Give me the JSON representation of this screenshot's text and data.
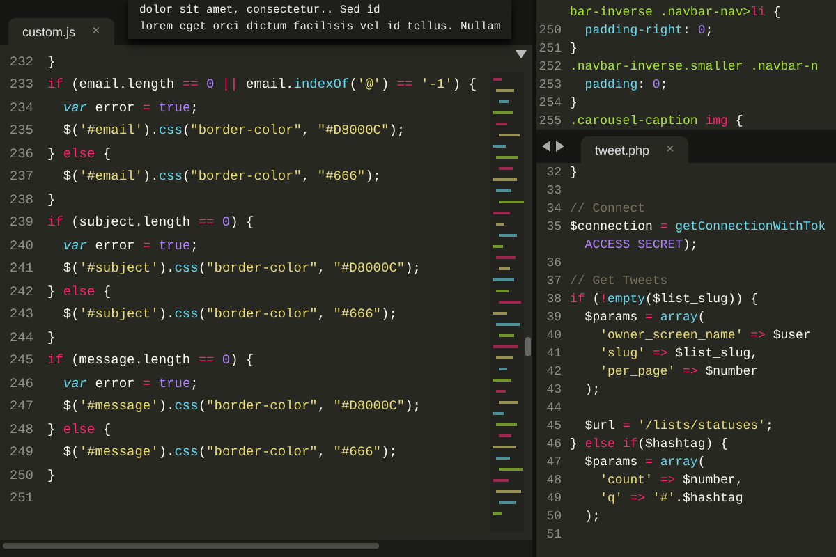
{
  "left_pane": {
    "tab": {
      "label": "custom.js",
      "close": "×"
    },
    "popup": {
      "lines": [
        "dolor sit amet, consectetur.. Sed id",
        "lorem eget orci dictum facilisis vel id tellus. Nullam"
      ]
    },
    "lines": [
      {
        "num": "232",
        "tokens": [
          {
            "kind": "txt",
            "text": "}"
          }
        ]
      },
      {
        "num": "233",
        "tokens": [
          {
            "kind": "kw",
            "text": "if"
          },
          {
            "kind": "txt",
            "text": " (email.length "
          },
          {
            "kind": "kw",
            "text": "=="
          },
          {
            "kind": "num",
            "text": " 0"
          },
          {
            "kind": "kw",
            "text": " ||"
          },
          {
            "kind": "txt",
            "text": " email."
          },
          {
            "kind": "fn",
            "text": "indexOf"
          },
          {
            "kind": "txt",
            "text": "("
          },
          {
            "kind": "str",
            "text": "'@'"
          },
          {
            "kind": "txt",
            "text": ") "
          },
          {
            "kind": "kw",
            "text": "=="
          },
          {
            "kind": "str",
            "text": " '-1'"
          },
          {
            "kind": "txt",
            "text": ") {"
          }
        ]
      },
      {
        "num": "234",
        "tokens": [
          {
            "kind": "var",
            "text": "  var"
          },
          {
            "kind": "txt",
            "text": " error "
          },
          {
            "kind": "kw",
            "text": "="
          },
          {
            "kind": "num",
            "text": " true"
          },
          {
            "kind": "txt",
            "text": ";"
          }
        ]
      },
      {
        "num": "235",
        "tokens": [
          {
            "kind": "txt",
            "text": "  $("
          },
          {
            "kind": "str",
            "text": "'#email'"
          },
          {
            "kind": "txt",
            "text": ")."
          },
          {
            "kind": "fn",
            "text": "css"
          },
          {
            "kind": "txt",
            "text": "("
          },
          {
            "kind": "str",
            "text": "\"border-color\""
          },
          {
            "kind": "txt",
            "text": ", "
          },
          {
            "kind": "str",
            "text": "\"#D8000C\""
          },
          {
            "kind": "txt",
            "text": ");"
          }
        ]
      },
      {
        "num": "236",
        "tokens": [
          {
            "kind": "txt",
            "text": "} "
          },
          {
            "kind": "kw",
            "text": "else"
          },
          {
            "kind": "txt",
            "text": " {"
          }
        ]
      },
      {
        "num": "237",
        "tokens": [
          {
            "kind": "txt",
            "text": "  $("
          },
          {
            "kind": "str",
            "text": "'#email'"
          },
          {
            "kind": "txt",
            "text": ")."
          },
          {
            "kind": "fn",
            "text": "css"
          },
          {
            "kind": "txt",
            "text": "("
          },
          {
            "kind": "str",
            "text": "\"border-color\""
          },
          {
            "kind": "txt",
            "text": ", "
          },
          {
            "kind": "str",
            "text": "\"#666\""
          },
          {
            "kind": "txt",
            "text": ");"
          }
        ]
      },
      {
        "num": "238",
        "tokens": [
          {
            "kind": "txt",
            "text": "}"
          }
        ]
      },
      {
        "num": "239",
        "tokens": [
          {
            "kind": "kw",
            "text": "if"
          },
          {
            "kind": "txt",
            "text": " (subject.length "
          },
          {
            "kind": "kw",
            "text": "=="
          },
          {
            "kind": "num",
            "text": " 0"
          },
          {
            "kind": "txt",
            "text": ") {"
          }
        ]
      },
      {
        "num": "240",
        "tokens": [
          {
            "kind": "var",
            "text": "  var"
          },
          {
            "kind": "txt",
            "text": " error "
          },
          {
            "kind": "kw",
            "text": "="
          },
          {
            "kind": "num",
            "text": " true"
          },
          {
            "kind": "txt",
            "text": ";"
          }
        ]
      },
      {
        "num": "241",
        "tokens": [
          {
            "kind": "txt",
            "text": "  $("
          },
          {
            "kind": "str",
            "text": "'#subject'"
          },
          {
            "kind": "txt",
            "text": ")."
          },
          {
            "kind": "fn",
            "text": "css"
          },
          {
            "kind": "txt",
            "text": "("
          },
          {
            "kind": "str",
            "text": "\"border-color\""
          },
          {
            "kind": "txt",
            "text": ", "
          },
          {
            "kind": "str",
            "text": "\"#D8000C\""
          },
          {
            "kind": "txt",
            "text": ");"
          }
        ]
      },
      {
        "num": "242",
        "tokens": [
          {
            "kind": "txt",
            "text": "} "
          },
          {
            "kind": "kw",
            "text": "else"
          },
          {
            "kind": "txt",
            "text": " {"
          }
        ]
      },
      {
        "num": "243",
        "tokens": [
          {
            "kind": "txt",
            "text": "  $("
          },
          {
            "kind": "str",
            "text": "'#subject'"
          },
          {
            "kind": "txt",
            "text": ")."
          },
          {
            "kind": "fn",
            "text": "css"
          },
          {
            "kind": "txt",
            "text": "("
          },
          {
            "kind": "str",
            "text": "\"border-color\""
          },
          {
            "kind": "txt",
            "text": ", "
          },
          {
            "kind": "str",
            "text": "\"#666\""
          },
          {
            "kind": "txt",
            "text": ");"
          }
        ]
      },
      {
        "num": "244",
        "tokens": [
          {
            "kind": "txt",
            "text": "}"
          }
        ]
      },
      {
        "num": "245",
        "tokens": [
          {
            "kind": "kw",
            "text": "if"
          },
          {
            "kind": "txt",
            "text": " (message.length "
          },
          {
            "kind": "kw",
            "text": "=="
          },
          {
            "kind": "num",
            "text": " 0"
          },
          {
            "kind": "txt",
            "text": ") {"
          }
        ]
      },
      {
        "num": "246",
        "tokens": [
          {
            "kind": "var",
            "text": "  var"
          },
          {
            "kind": "txt",
            "text": " error "
          },
          {
            "kind": "kw",
            "text": "="
          },
          {
            "kind": "num",
            "text": " true"
          },
          {
            "kind": "txt",
            "text": ";"
          }
        ]
      },
      {
        "num": "247",
        "tokens": [
          {
            "kind": "txt",
            "text": "  $("
          },
          {
            "kind": "str",
            "text": "'#message'"
          },
          {
            "kind": "txt",
            "text": ")."
          },
          {
            "kind": "fn",
            "text": "css"
          },
          {
            "kind": "txt",
            "text": "("
          },
          {
            "kind": "str",
            "text": "\"border-color\""
          },
          {
            "kind": "txt",
            "text": ", "
          },
          {
            "kind": "str",
            "text": "\"#D8000C\""
          },
          {
            "kind": "txt",
            "text": ");"
          }
        ]
      },
      {
        "num": "248",
        "tokens": [
          {
            "kind": "txt",
            "text": "} "
          },
          {
            "kind": "kw",
            "text": "else"
          },
          {
            "kind": "txt",
            "text": " {"
          }
        ]
      },
      {
        "num": "249",
        "tokens": [
          {
            "kind": "txt",
            "text": "  $("
          },
          {
            "kind": "str",
            "text": "'#message'"
          },
          {
            "kind": "txt",
            "text": ")."
          },
          {
            "kind": "fn",
            "text": "css"
          },
          {
            "kind": "txt",
            "text": "("
          },
          {
            "kind": "str",
            "text": "\"border-color\""
          },
          {
            "kind": "txt",
            "text": ", "
          },
          {
            "kind": "str",
            "text": "\"#666\""
          },
          {
            "kind": "txt",
            "text": ");"
          }
        ]
      },
      {
        "num": "250",
        "tokens": [
          {
            "kind": "txt",
            "text": "}"
          }
        ]
      },
      {
        "num": "251"
      }
    ]
  },
  "right_top_pane": {
    "lines": [
      {
        "tokens": [
          {
            "kind": "sel",
            "text": "bar-inverse .navbar-nav>"
          },
          {
            "kind": "kw",
            "text": "li"
          },
          {
            "kind": "txt",
            "text": " {"
          }
        ]
      },
      {
        "num": "250",
        "tokens": [
          {
            "kind": "prop",
            "text": "  padding-right"
          },
          {
            "kind": "txt",
            "text": ": "
          },
          {
            "kind": "num",
            "text": "0"
          },
          {
            "kind": "txt",
            "text": ";"
          }
        ]
      },
      {
        "num": "251",
        "tokens": [
          {
            "kind": "txt",
            "text": "}"
          }
        ]
      },
      {
        "num": "252",
        "tokens": [
          {
            "kind": "sel",
            "text": ".navbar-inverse.smaller .navbar-n"
          }
        ]
      },
      {
        "num": "253",
        "tokens": [
          {
            "kind": "prop",
            "text": "  padding"
          },
          {
            "kind": "txt",
            "text": ": "
          },
          {
            "kind": "num",
            "text": "0"
          },
          {
            "kind": "txt",
            "text": ";"
          }
        ]
      },
      {
        "num": "254",
        "tokens": [
          {
            "kind": "txt",
            "text": "}"
          }
        ]
      },
      {
        "num": "255",
        "tokens": [
          {
            "kind": "sel",
            "text": ".carousel-caption "
          },
          {
            "kind": "kw",
            "text": "img"
          },
          {
            "kind": "txt",
            "text": " {"
          }
        ]
      }
    ]
  },
  "right_bottom_pane": {
    "tab": {
      "label": "tweet.php",
      "close": "×"
    },
    "lines": [
      {
        "num": "32",
        "tokens": [
          {
            "kind": "txt",
            "text": "}"
          }
        ]
      },
      {
        "num": "33"
      },
      {
        "num": "34",
        "tokens": [
          {
            "kind": "cm",
            "text": "// Connect"
          }
        ]
      },
      {
        "num": "35",
        "tokens": [
          {
            "kind": "txt",
            "text": "$connection "
          },
          {
            "kind": "kw",
            "text": "="
          },
          {
            "kind": "fn",
            "text": " getConnectionWithTok"
          }
        ]
      },
      {
        "tokens": [
          {
            "kind": "num",
            "text": "  ACCESS_SECRET"
          },
          {
            "kind": "txt",
            "text": ");"
          }
        ]
      },
      {
        "num": "36"
      },
      {
        "num": "37",
        "tokens": [
          {
            "kind": "cm",
            "text": "// Get Tweets"
          }
        ]
      },
      {
        "num": "38",
        "tokens": [
          {
            "kind": "kw",
            "text": "if"
          },
          {
            "kind": "txt",
            "text": " ("
          },
          {
            "kind": "kw",
            "text": "!"
          },
          {
            "kind": "fn",
            "text": "empty"
          },
          {
            "kind": "txt",
            "text": "($list_slug)) {"
          }
        ]
      },
      {
        "num": "39",
        "tokens": [
          {
            "kind": "txt",
            "text": "  $params "
          },
          {
            "kind": "kw",
            "text": "="
          },
          {
            "kind": "fn",
            "text": " array"
          },
          {
            "kind": "txt",
            "text": "("
          }
        ]
      },
      {
        "num": "40",
        "tokens": [
          {
            "kind": "str",
            "text": "    'owner_screen_name'"
          },
          {
            "kind": "kw",
            "text": " =>"
          },
          {
            "kind": "txt",
            "text": " $user"
          }
        ]
      },
      {
        "num": "41",
        "tokens": [
          {
            "kind": "str",
            "text": "    'slug'"
          },
          {
            "kind": "kw",
            "text": " =>"
          },
          {
            "kind": "txt",
            "text": " $list_slug,"
          }
        ]
      },
      {
        "num": "42",
        "tokens": [
          {
            "kind": "str",
            "text": "    'per_page'"
          },
          {
            "kind": "kw",
            "text": " =>"
          },
          {
            "kind": "txt",
            "text": " $number"
          }
        ]
      },
      {
        "num": "43",
        "tokens": [
          {
            "kind": "txt",
            "text": "  );"
          }
        ]
      },
      {
        "num": "44"
      },
      {
        "num": "45",
        "tokens": [
          {
            "kind": "txt",
            "text": "  $url "
          },
          {
            "kind": "kw",
            "text": "="
          },
          {
            "kind": "str",
            "text": " '/lists/statuses'"
          },
          {
            "kind": "txt",
            "text": ";"
          }
        ]
      },
      {
        "num": "46",
        "tokens": [
          {
            "kind": "txt",
            "text": "} "
          },
          {
            "kind": "kw",
            "text": "else if"
          },
          {
            "kind": "txt",
            "text": "($hashtag) {"
          }
        ]
      },
      {
        "num": "47",
        "tokens": [
          {
            "kind": "txt",
            "text": "  $params "
          },
          {
            "kind": "kw",
            "text": "="
          },
          {
            "kind": "fn",
            "text": " array"
          },
          {
            "kind": "txt",
            "text": "("
          }
        ]
      },
      {
        "num": "48",
        "tokens": [
          {
            "kind": "str",
            "text": "    'count'"
          },
          {
            "kind": "kw",
            "text": " =>"
          },
          {
            "kind": "txt",
            "text": " $number,"
          }
        ]
      },
      {
        "num": "49",
        "tokens": [
          {
            "kind": "str",
            "text": "    'q'"
          },
          {
            "kind": "kw",
            "text": " =>"
          },
          {
            "kind": "str",
            "text": " '#'"
          },
          {
            "kind": "txt",
            "text": ".$hashtag"
          }
        ]
      },
      {
        "num": "50",
        "tokens": [
          {
            "kind": "txt",
            "text": "  );"
          }
        ]
      },
      {
        "num": "51"
      }
    ]
  }
}
